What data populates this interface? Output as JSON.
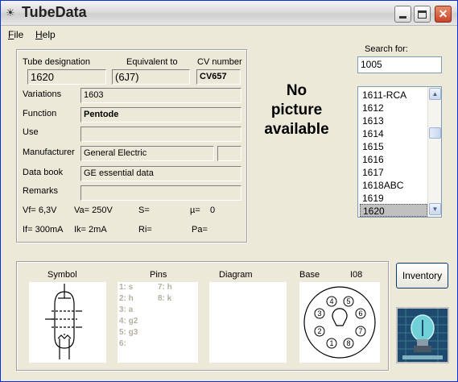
{
  "window": {
    "title": "TubeData"
  },
  "menu": {
    "file": "File",
    "file_key": "F",
    "file_rest": "ile",
    "help": "Help",
    "help_key": "H",
    "help_rest": "elp"
  },
  "details": {
    "designation_label": "Tube designation",
    "designation": "1620",
    "equivalent_label": "Equivalent to",
    "equivalent": "(6J7)",
    "cv_label": "CV number",
    "cv": "CV657",
    "variations_label": "Variations",
    "variations": "1603",
    "function_label": "Function",
    "function": "Pentode",
    "use_label": "Use",
    "use": "",
    "manufacturer_label": "Manufacturer",
    "manufacturer": "General Electric",
    "manufacturer_extra": "",
    "databook_label": "Data book",
    "databook": "GE essential data",
    "remarks_label": "Remarks",
    "remarks": "",
    "vf": "Vf= 6,3V",
    "va": "Va=  250V",
    "s": "S=",
    "mu_label": "µ=",
    "mu": "0",
    "if": "If= 300mA",
    "ik": "Ik=  2mA",
    "ri": "Ri=",
    "pa": "Pa="
  },
  "picture": {
    "line1": "No",
    "line2": "picture",
    "line3": "available"
  },
  "search": {
    "label": "Search for:",
    "value": "1005"
  },
  "tube_list": {
    "items": [
      "1611-RCA",
      "1612",
      "1613",
      "1614",
      "1615",
      "1616",
      "1617",
      "1618ABC",
      "1619",
      "1620"
    ],
    "selected": "1620"
  },
  "bottom": {
    "symbol_label": "Symbol",
    "pins_label": "Pins",
    "diagram_label": "Diagram",
    "base_label": "Base",
    "base_type": "I08",
    "pins_left": [
      "1: s",
      "2: h",
      "3: a",
      "4: g2",
      "5: g3",
      "6:"
    ],
    "pins_right": [
      "7: h",
      "8: k"
    ],
    "base_pins": [
      "1",
      "2",
      "3",
      "4",
      "5",
      "6",
      "7",
      "8"
    ]
  },
  "buttons": {
    "inventory": "Inventory"
  },
  "icons": {
    "app": "lightbulb-icon",
    "min": "minimize-icon",
    "max": "maximize-icon",
    "close": "close-icon"
  },
  "colors": {
    "close_button": "#c8452a",
    "selection": "#c0c0c0",
    "window_bg": "#ece9d8"
  }
}
